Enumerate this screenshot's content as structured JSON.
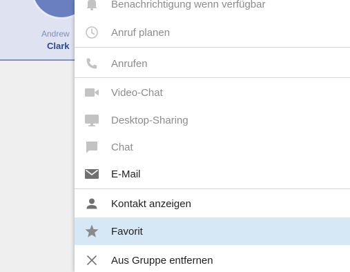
{
  "contact": {
    "first_name": "Andrew",
    "last_name": "Clark"
  },
  "menu": {
    "items": [
      {
        "label": "Benachrichtigung wenn verfügbar",
        "icon": "bell-icon",
        "enabled": false
      },
      {
        "label": "Anruf planen",
        "icon": "clock-icon",
        "enabled": false
      },
      {
        "label": "Anrufen",
        "icon": "phone-icon",
        "enabled": false
      },
      {
        "label": "Video-Chat",
        "icon": "video-camera-icon",
        "enabled": false
      },
      {
        "label": "Desktop-Sharing",
        "icon": "monitor-icon",
        "enabled": false
      },
      {
        "label": "Chat",
        "icon": "chat-bubble-icon",
        "enabled": false
      },
      {
        "label": "E-Mail",
        "icon": "envelope-icon",
        "enabled": true
      },
      {
        "label": "Kontakt anzeigen",
        "icon": "person-icon",
        "enabled": true
      },
      {
        "label": "Favorit",
        "icon": "star-icon",
        "enabled": true,
        "highlighted": true
      },
      {
        "label": "Aus Gruppe entfernen",
        "icon": "close-icon",
        "enabled": true
      }
    ]
  },
  "colors": {
    "highlight": "#d6e8f5",
    "disabled_text": "#8c8c8c",
    "enabled_text": "#1f1f1f",
    "icon_disabled": "#c3c3c3",
    "icon_enabled": "#707070",
    "contact_card": "#dfe3f1"
  }
}
